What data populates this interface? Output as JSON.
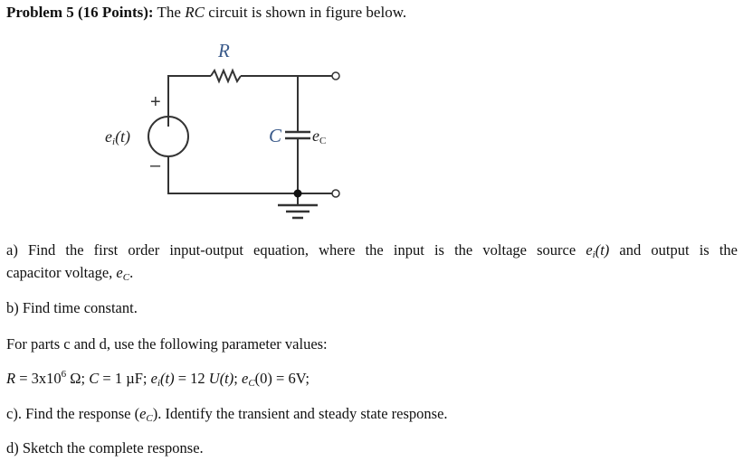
{
  "header": {
    "problem_label": "Problem 5 (16 Points):",
    "intro_pre": " The ",
    "intro_var": "RC",
    "intro_post": " circuit is shown in figure below."
  },
  "circuit": {
    "resistor_label": "R",
    "capacitor_label": "C",
    "capacitor_voltage_label_base": "e",
    "capacitor_voltage_label_sub": "C",
    "source_label_base": "e",
    "source_label_sub": "i",
    "source_label_arg": "(t)",
    "plus_sign": "+",
    "minus_sign": "–",
    "line_color": "#333333",
    "label_color": "#3a5a8a"
  },
  "parts": {
    "a_line1_pre": "a) Find the first order input-output equation, where the input is the voltage source ",
    "a_line1_var_base": "e",
    "a_line1_var_sub": "i",
    "a_line1_var_arg": "(t)",
    "a_line1_post": " and output is the",
    "a_line2_pre": "capacitor voltage, ",
    "a_line2_var_base": "e",
    "a_line2_var_sub": "C",
    "a_line2_post": ".",
    "b": "b) Find time constant.",
    "params_intro": "For parts c and d, use the following parameter values:",
    "params": {
      "R_var": "R",
      "R_eq": " = 3x10",
      "R_exp": "6",
      "R_unit": " Ω; ",
      "C_var": "C",
      "C_eq": " = 1 µF; ",
      "ei_base": "e",
      "ei_sub": "i",
      "ei_arg": "(t)",
      "ei_eq": " = 12 ",
      "U_var": "U",
      "U_arg": "(t)",
      "sep": "; ",
      "ec_base": "e",
      "ec_sub": "C",
      "ec_eq": "(0) = 6V;"
    },
    "c_pre": "c). Find the response (",
    "c_var_base": "e",
    "c_var_sub": "C",
    "c_post": "). Identify the transient and steady state response.",
    "d": "d) Sketch the complete response."
  }
}
